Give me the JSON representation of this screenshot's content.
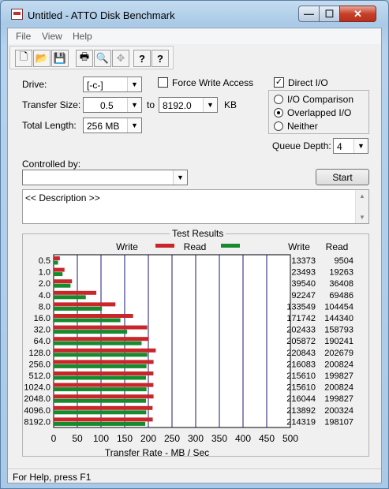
{
  "window": {
    "title": "Untitled - ATTO Disk Benchmark",
    "controls": {
      "minimize": "—",
      "maximize": "☐",
      "close": "✕"
    }
  },
  "menu": [
    "File",
    "View",
    "Help"
  ],
  "toolbar": [
    {
      "name": "new-icon",
      "glyph": "🗋"
    },
    {
      "name": "open-icon",
      "glyph": "📂"
    },
    {
      "name": "save-icon",
      "glyph": "💾"
    },
    {
      "name": "print-icon",
      "glyph": "🖶"
    },
    {
      "name": "print-preview-icon",
      "glyph": "🔍"
    },
    {
      "name": "move-icon",
      "glyph": "✥"
    },
    {
      "name": "help-icon",
      "glyph": "?"
    },
    {
      "name": "context-help-icon",
      "glyph": "?"
    }
  ],
  "settings": {
    "drive_label": "Drive:",
    "drive_value": "[-c-]",
    "force_write_label": "Force Write Access",
    "force_write_checked": false,
    "direct_io_label": "Direct I/O",
    "direct_io_checked": true,
    "transfer_size_label": "Transfer Size:",
    "transfer_from": "0.5",
    "to_label": "to",
    "transfer_to": "8192.0",
    "kb_label": "KB",
    "total_length_label": "Total Length:",
    "total_length_value": "256 MB",
    "io_comparison_label": "I/O Comparison",
    "overlapped_io_label": "Overlapped I/O",
    "neither_label": "Neither",
    "selected_mode": "Overlapped I/O",
    "queue_depth_label": "Queue Depth:",
    "queue_depth_value": "4",
    "controlled_by_label": "Controlled by:",
    "controlled_by_value": "",
    "start_label": "Start",
    "description_text": "<< Description >>"
  },
  "results": {
    "title": "Test Results",
    "write_legend": "Write",
    "read_legend": "Read",
    "write_col": "Write",
    "read_col": "Read",
    "write_color": "#c8262a",
    "read_color": "#178a2e",
    "rows": [
      {
        "size": "0.5",
        "write": "13373",
        "read": "9504"
      },
      {
        "size": "1.0",
        "write": "23493",
        "read": "19263"
      },
      {
        "size": "2.0",
        "write": "39540",
        "read": "36408"
      },
      {
        "size": "4.0",
        "write": "92247",
        "read": "69486"
      },
      {
        "size": "8.0",
        "write": "133549",
        "read": "104454"
      },
      {
        "size": "16.0",
        "write": "171742",
        "read": "144340"
      },
      {
        "size": "32.0",
        "write": "202433",
        "read": "158793"
      },
      {
        "size": "64.0",
        "write": "205872",
        "read": "190241"
      },
      {
        "size": "128.0",
        "write": "220843",
        "read": "202679"
      },
      {
        "size": "256.0",
        "write": "216083",
        "read": "200824"
      },
      {
        "size": "512.0",
        "write": "215610",
        "read": "199827"
      },
      {
        "size": "1024.0",
        "write": "215610",
        "read": "200824"
      },
      {
        "size": "2048.0",
        "write": "216044",
        "read": "199827"
      },
      {
        "size": "4096.0",
        "write": "213892",
        "read": "200324"
      },
      {
        "size": "8192.0",
        "write": "214319",
        "read": "198107"
      }
    ]
  },
  "chart_data": {
    "type": "bar",
    "orientation": "horizontal",
    "categories": [
      "0.5",
      "1.0",
      "2.0",
      "4.0",
      "8.0",
      "16.0",
      "32.0",
      "64.0",
      "128.0",
      "256.0",
      "512.0",
      "1024.0",
      "2048.0",
      "4096.0",
      "8192.0"
    ],
    "series": [
      {
        "name": "Write",
        "values": [
          13.1,
          22.9,
          38.6,
          90.1,
          130.4,
          167.7,
          197.7,
          201.0,
          215.7,
          211.0,
          210.6,
          210.6,
          211.0,
          208.9,
          209.3
        ]
      },
      {
        "name": "Read",
        "values": [
          9.3,
          18.8,
          35.6,
          67.9,
          102.0,
          141.0,
          155.1,
          185.8,
          197.9,
          196.1,
          195.1,
          196.1,
          195.1,
          195.6,
          193.5
        ]
      }
    ],
    "xlabel": "Transfer Rate - MB / Sec",
    "xticks": [
      "0",
      "50",
      "100",
      "150",
      "200",
      "250",
      "300",
      "350",
      "400",
      "450",
      "500"
    ],
    "xlim": [
      0,
      500
    ],
    "grid": true,
    "legend": "top"
  },
  "status": "For Help, press F1"
}
